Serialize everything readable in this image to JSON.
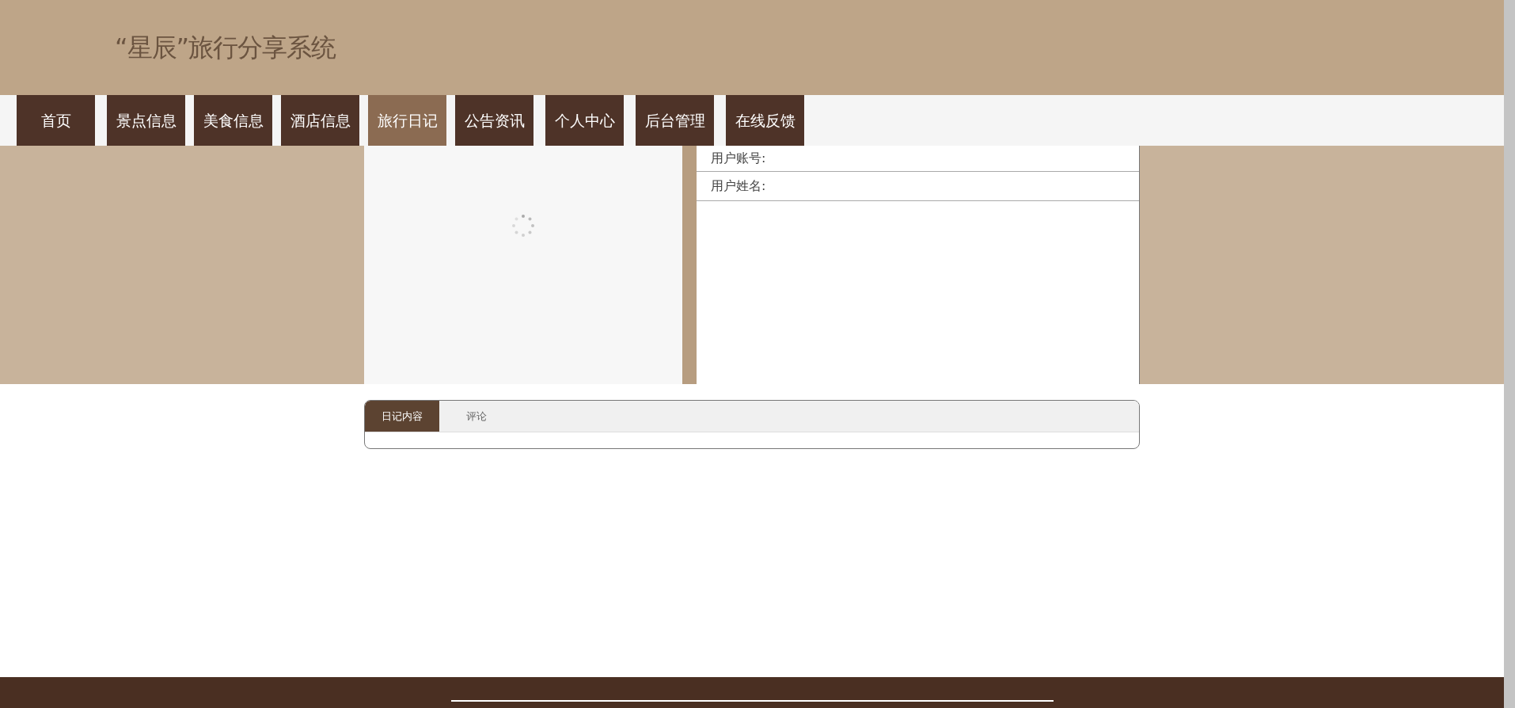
{
  "site_title": "“星辰”旅行分享系统",
  "nav": [
    {
      "label": "首页",
      "selected": false
    },
    {
      "label": "景点信息",
      "selected": false
    },
    {
      "label": "美食信息",
      "selected": false
    },
    {
      "label": "酒店信息",
      "selected": false
    },
    {
      "label": "旅行日记",
      "selected": true
    },
    {
      "label": "公告资讯",
      "selected": false
    },
    {
      "label": "个人中心",
      "selected": false
    },
    {
      "label": "后台管理",
      "selected": false
    },
    {
      "label": "在线反馈",
      "selected": false
    }
  ],
  "user_fields": [
    {
      "label": "用户账号:"
    },
    {
      "label": "用户姓名:"
    }
  ],
  "tabs": [
    {
      "label": "日记内容",
      "selected": true
    },
    {
      "label": "评论",
      "selected": false
    }
  ]
}
